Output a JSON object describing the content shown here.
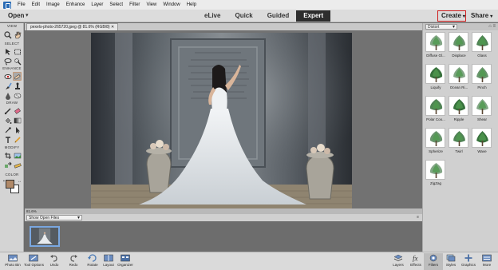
{
  "menubar": {
    "items": [
      "File",
      "Edit",
      "Image",
      "Enhance",
      "Layer",
      "Select",
      "Filter",
      "View",
      "Window",
      "Help"
    ]
  },
  "topbar": {
    "open_label": "Open",
    "modes": [
      "eLive",
      "Quick",
      "Guided",
      "Expert"
    ],
    "active_mode": "Expert",
    "create_label": "Create",
    "share_label": "Share"
  },
  "toolbox": {
    "sections": [
      "VIEW",
      "SELECT",
      "ENHANCE",
      "DRAW",
      "MODIFY",
      "COLOR"
    ],
    "icons": [
      "zoom-icon",
      "hand-icon",
      "move-icon",
      "marquee-icon",
      "lasso-icon",
      "quick-selection-icon",
      "red-eye-icon",
      "spot-healing-icon",
      "smart-brush-icon",
      "clone-stamp-icon",
      "blur-icon",
      "sponge-icon",
      "brush-icon",
      "eraser-icon",
      "paint-bucket-icon",
      "gradient-icon",
      "color-picker-icon",
      "custom-shape-icon",
      "type-icon",
      "pencil-icon",
      "crop-icon",
      "recompose-icon",
      "content-aware-move-icon",
      "straighten-icon"
    ],
    "foreground_color": "#b08968",
    "background_color": "#ffffff"
  },
  "document": {
    "tab_title": "pexels-photo-265720.jpeg @ 81.6% (RGB/8)",
    "zoom_text": "81.6%"
  },
  "photo_bin": {
    "show_label": "Show Open Files"
  },
  "right_panel": {
    "category": "Distort",
    "filters": [
      "Diffuse Gl...",
      "Displace",
      "Glass",
      "Liquify",
      "Ocean Ri...",
      "Pinch",
      "Polar Coo...",
      "Ripple",
      "Shear",
      "Spherize",
      "Twirl",
      "Wave",
      "ZigZag"
    ]
  },
  "bottombar": {
    "left": [
      "Photo Bin",
      "Tool Options",
      "Undo",
      "Redo",
      "Rotate",
      "Layout",
      "Organizer"
    ],
    "right": [
      "Layers",
      "Effects",
      "Filters",
      "Styles",
      "Graphics",
      "More"
    ],
    "active": "Filters"
  }
}
